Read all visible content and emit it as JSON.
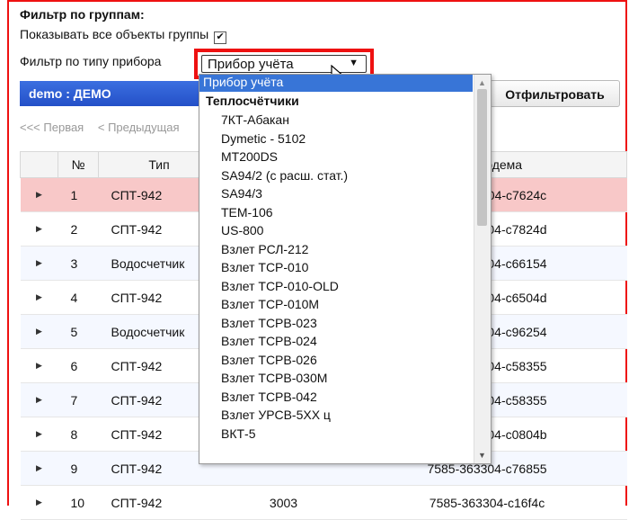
{
  "filter": {
    "heading": "Фильтр по группам:",
    "show_all_label": "Показывать все объекты группы",
    "show_all_checked": "✔",
    "device_type_label": "Фильтр по типу прибора",
    "device_type_value": "Прибор учёта"
  },
  "bluebar": {
    "title": "demo : ДЕМО"
  },
  "filter_button": "Отфильтровать",
  "pager": {
    "first": "<<< Первая",
    "prev": "< Предыдущая"
  },
  "table": {
    "headers": [
      "",
      "№",
      "Тип",
      "",
      "Код модема"
    ],
    "rows": [
      {
        "num": "1",
        "type": "СПТ-942",
        "mid": "",
        "code": "7585-363304-c7624c"
      },
      {
        "num": "2",
        "type": "СПТ-942",
        "mid": "",
        "code": "7585-363304-c7824d"
      },
      {
        "num": "3",
        "type": "Водосчетчик",
        "mid": "",
        "code": "7585-363304-c66154"
      },
      {
        "num": "4",
        "type": "СПТ-942",
        "mid": "",
        "code": "7585-363304-c6504d"
      },
      {
        "num": "5",
        "type": "Водосчетчик",
        "mid": "",
        "code": "7585-363304-c96254"
      },
      {
        "num": "6",
        "type": "СПТ-942",
        "mid": "",
        "code": "7585-363304-c58355"
      },
      {
        "num": "7",
        "type": "СПТ-942",
        "mid": "",
        "code": "7585-363304-c58355"
      },
      {
        "num": "8",
        "type": "СПТ-942",
        "mid": "",
        "code": "7585-363304-c0804b"
      },
      {
        "num": "9",
        "type": "СПТ-942",
        "mid": "",
        "code": "7585-363304-c76855"
      },
      {
        "num": "10",
        "type": "СПТ-942",
        "mid": "3003",
        "code": "7585-363304-c16f4c"
      }
    ]
  },
  "dropdown": {
    "selected": "Прибор учёта",
    "group": "Теплосчётчики",
    "items": [
      "7КТ-Абакан",
      "Dymetic - 5102",
      "MT200DS",
      "SA94/2 (с расш. стат.)",
      "SA94/3",
      "TEM-106",
      "US-800",
      "Взлет РСЛ-212",
      "Взлет ТСР-010",
      "Взлет ТСР-010-OLD",
      "Взлет ТСР-010М",
      "Взлет ТСРВ-023",
      "Взлет ТСРВ-024",
      "Взлет ТСРВ-026",
      "Взлет ТСРВ-030М",
      "Взлет ТСРВ-042",
      "Взлет УРСВ-5ХХ ц",
      "ВКТ-5"
    ]
  }
}
